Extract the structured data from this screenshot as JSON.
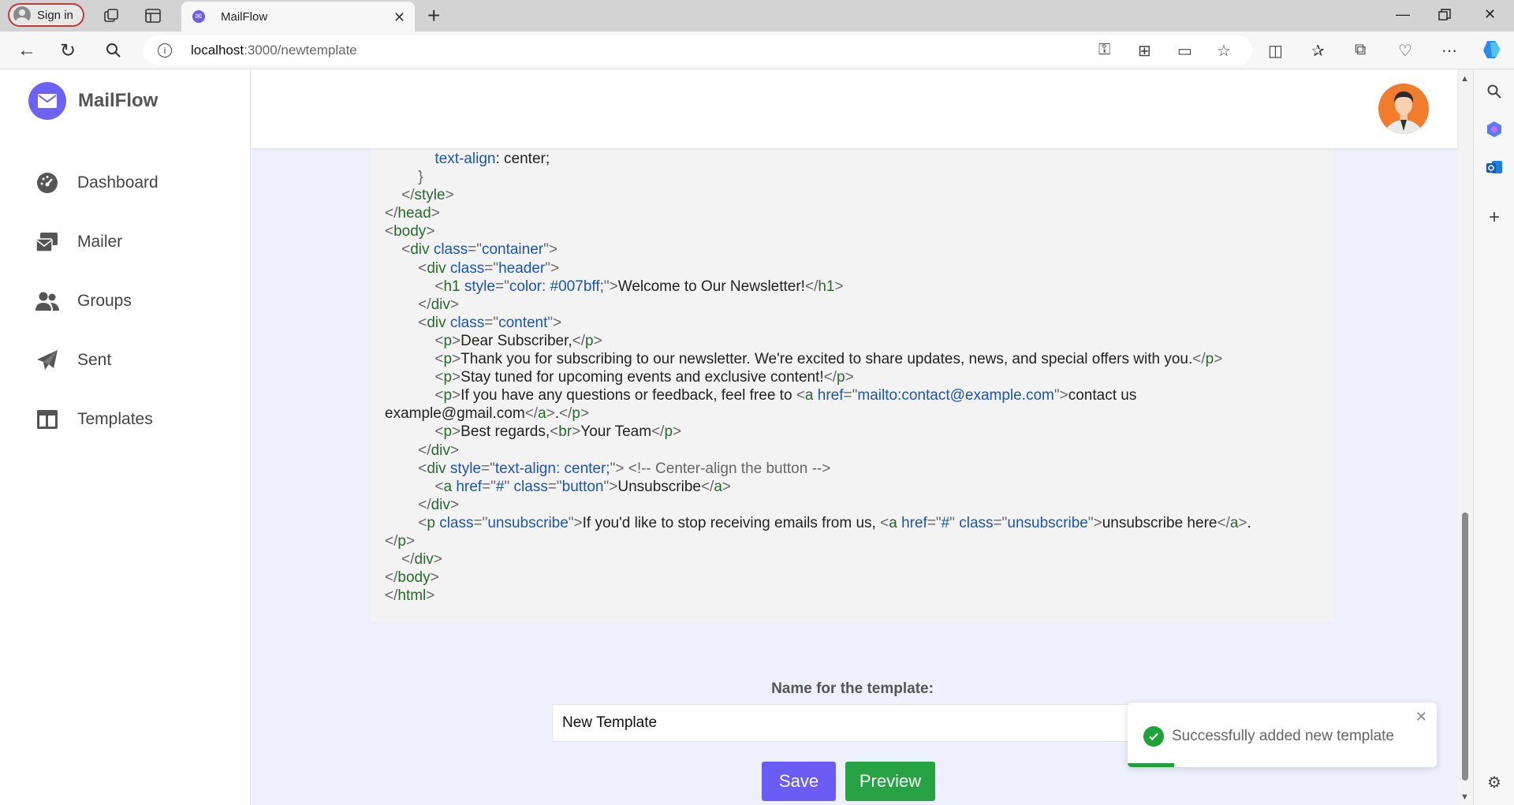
{
  "browser": {
    "signin_label": "Sign in",
    "tab_title": "MailFlow",
    "url_host": "localhost",
    "url_path": ":3000/newtemplate"
  },
  "sidebar": {
    "brand": "MailFlow",
    "items": [
      {
        "label": "Dashboard",
        "icon": "dashboard-gauge-icon"
      },
      {
        "label": "Mailer",
        "icon": "mailer-icon"
      },
      {
        "label": "Groups",
        "icon": "groups-icon"
      },
      {
        "label": "Sent",
        "icon": "paper-plane-icon"
      },
      {
        "label": "Templates",
        "icon": "templates-icon"
      }
    ]
  },
  "code": {
    "l1": "text-align",
    "l1b": ": center;",
    "h1_text": "Welcome to Our Newsletter!",
    "p1": "Dear Subscriber,",
    "p2": "Thank you for subscribing to our newsletter. We're excited to share updates, news, and special offers with you.",
    "p3": "Stay tuned for upcoming events and exclusive content!",
    "p4": "If you have any questions or feedback, feel free to ",
    "mailto": "mailto:contact@example.com",
    "contact_text": "contact us",
    "wrap_email": "example@gmail.com",
    "p5a": "Best regards,",
    "p5b": "Your Team",
    "comment": "<!-- Center-align the button -->",
    "unsub_btn": "Unsubscribe",
    "p6": "If you'd like to stop receiving emails from us, ",
    "unsub_link": "unsubscribe here",
    "cls_container": "container",
    "cls_header": "header",
    "cls_content": "content",
    "cls_button": "button",
    "cls_unsubscribe": "unsubscribe",
    "style_h1": "color: #007bff;",
    "style_center": "text-align: center;",
    "href_hash": "#"
  },
  "form": {
    "label": "Name for the template:",
    "value": "New Template",
    "save": "Save",
    "preview": "Preview"
  },
  "toast": {
    "message": "Successfully added new template",
    "progress": 0.15
  },
  "colors": {
    "accent": "#6b5cf6",
    "success": "#27a244"
  }
}
